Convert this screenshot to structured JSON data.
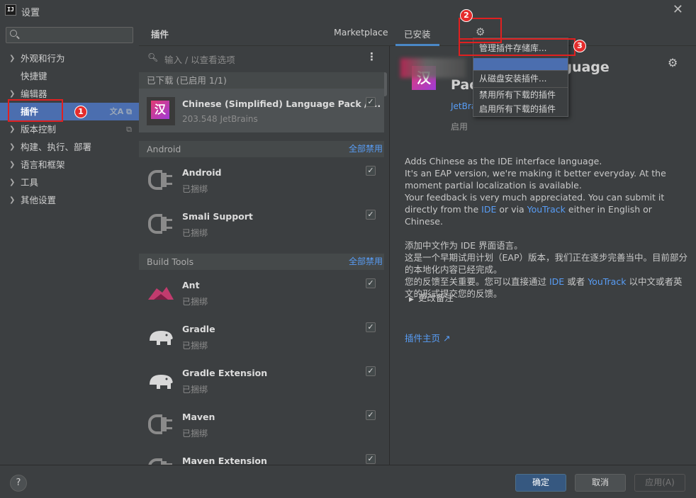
{
  "window": {
    "title": "设置",
    "logo": "IJ"
  },
  "sidebar": {
    "items": [
      {
        "label": "外观和行为",
        "expandable": true
      },
      {
        "label": "快捷键",
        "expandable": false
      },
      {
        "label": "编辑器",
        "expandable": true
      },
      {
        "label": "插件",
        "expandable": false,
        "active": true
      },
      {
        "label": "版本控制",
        "expandable": true
      },
      {
        "label": "构建、执行、部署",
        "expandable": true
      },
      {
        "label": "语言和框架",
        "expandable": true
      },
      {
        "label": "工具",
        "expandable": true
      },
      {
        "label": "其他设置",
        "expandable": true
      }
    ]
  },
  "header": {
    "title": "插件",
    "tab_marketplace": "Marketplace",
    "tab_installed": "已安装"
  },
  "list": {
    "search_placeholder": "输入 / 以查看选项",
    "groups": [
      {
        "title": "已下载 (已启用 1/1)",
        "disable_all": ""
      },
      {
        "title": "Android",
        "disable_all": "全部禁用"
      },
      {
        "title": "Build Tools",
        "disable_all": "全部禁用"
      }
    ],
    "plugins": [
      {
        "name": "Chinese (Simplified) Language Pack / ...",
        "meta": "203.548  JetBrains",
        "checked": true,
        "icon": "language-pack-icon",
        "glyph": "汉"
      },
      {
        "name": "Android",
        "meta": "已捆绑",
        "checked": true,
        "icon": "plug-icon"
      },
      {
        "name": "Smali Support",
        "meta": "已捆绑",
        "checked": true,
        "icon": "plug-icon"
      },
      {
        "name": "Ant",
        "meta": "已捆绑",
        "checked": true,
        "icon": "ant-icon"
      },
      {
        "name": "Gradle",
        "meta": "已捆绑",
        "checked": true,
        "icon": "elephant-icon"
      },
      {
        "name": "Gradle Extension",
        "meta": "已捆绑",
        "checked": true,
        "icon": "elephant-icon"
      },
      {
        "name": "Maven",
        "meta": "已捆绑",
        "checked": true,
        "icon": "plug-icon"
      },
      {
        "name": "Maven Extension",
        "meta": "",
        "checked": true,
        "icon": "plug-icon"
      }
    ]
  },
  "detail": {
    "title_line1": "d) Language",
    "title_line2": "Pac",
    "vendor": "JetBra",
    "status": "启用",
    "desc_en_1": "Adds Chinese as the IDE interface language.",
    "desc_en_2": "It's an EAP version, we're making it better everyday. At the moment partial localization is available.",
    "desc_en_3a": "Your feedback is very much appreciated. You can submit it directly from the",
    "desc_en_3_link1": "IDE",
    "desc_en_3b": "or via",
    "desc_en_3_link2": "YouTrack",
    "desc_en_3c": "either in English or Chinese.",
    "desc_zh_1": "添加中文作为 IDE 界面语言。",
    "desc_zh_2": "这是一个早期试用计划（EAP）版本，我们正在逐步完善当中。目前部分的本地化内容已经完成。",
    "desc_zh_3a": "您的反馈至关重要。您可以直接通过",
    "desc_zh_3_link1": "IDE",
    "desc_zh_3b": "或者",
    "desc_zh_3_link2": "YouTrack",
    "desc_zh_3c": "以中文或者英文的形式提交您的反馈。",
    "change_notes": "更改备注",
    "homepage": "插件主页 ↗"
  },
  "dropdown": {
    "items": [
      "管理插件存储库...",
      "从磁盘安装插件...",
      "禁用所有下载的插件",
      "启用所有下载的插件"
    ]
  },
  "footer": {
    "ok": "确定",
    "cancel": "取消",
    "apply": "应用(A)",
    "help": "?"
  },
  "annotations": {
    "badge1": "1",
    "badge2": "2",
    "badge3": "3"
  },
  "colors": {
    "accent": "#4b6eaf",
    "link": "#589df6",
    "annotation": "#e02020"
  }
}
